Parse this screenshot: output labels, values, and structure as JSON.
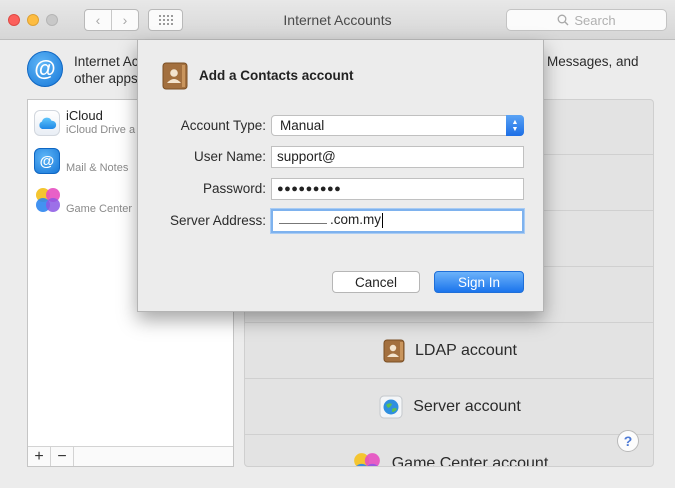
{
  "window": {
    "title": "Internet Accounts",
    "search_placeholder": "Search",
    "nav_back": "‹",
    "nav_forward": "›"
  },
  "header": {
    "text_left_line1": "Internet Ac",
    "text_left_line2": "other apps",
    "text_right": "Messages, and"
  },
  "sidebar": {
    "accounts": [
      {
        "name": "iCloud",
        "sub": "iCloud Drive a"
      },
      {
        "name": "",
        "sub": "Mail & Notes"
      },
      {
        "name": "",
        "sub": "Game Center"
      }
    ],
    "add": "+",
    "remove": "−"
  },
  "providers": [
    {
      "label": "LDAP account"
    },
    {
      "label": "Server account"
    },
    {
      "label": "Game Center account"
    }
  ],
  "help": "?",
  "sheet": {
    "title": "Add a Contacts account",
    "account_type_label": "Account Type:",
    "account_type_value": "Manual",
    "username_label": "User Name:",
    "username_value": "support@",
    "password_label": "Password:",
    "password_value": "●●●●●●●●●",
    "server_label": "Server Address:",
    "server_value": ".com.my",
    "cancel_label": "Cancel",
    "signin_label": "Sign In"
  },
  "colors": {
    "accent": "#1b74ec",
    "window_bg": "#ececec"
  }
}
